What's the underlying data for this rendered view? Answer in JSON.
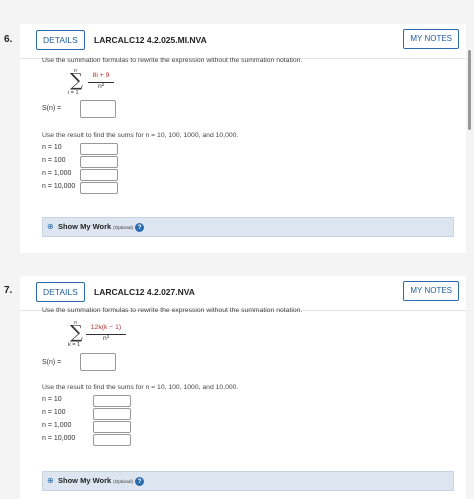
{
  "problems": [
    {
      "number": "6.",
      "details_label": "DETAILS",
      "code": "LARCALC12 4.2.025.MI.NVA",
      "notes_label": "MY NOTES",
      "instruction": "Use the summation formulas to rewrite the expression without the summation notation.",
      "sum_upper": "n",
      "sum_lower": "i = 1",
      "frac_num": "8i + 9",
      "frac_den": "n²",
      "sn_label": "S(n) =",
      "result_instruction": "Use the result to find the sums for n = 10, 100, 1000, and 10,000.",
      "rows": [
        "n =    10",
        "n =   100",
        "n = 1,000",
        "n = 10,000"
      ],
      "show_work": "Show My Work",
      "optional": "(Optional)"
    },
    {
      "number": "7.",
      "details_label": "DETAILS",
      "code": "LARCALC12 4.2.027.NVA",
      "notes_label": "MY NOTES",
      "instruction": "Use the summation formulas to rewrite the expression without the summation notation.",
      "sum_upper": "n",
      "sum_lower": "k = 1",
      "frac_num": "12k(k − 1)",
      "frac_den": "n³",
      "sn_label": "S(n) =",
      "result_instruction": "Use the result to find the sums for n = 10, 100, 1000, and 10,000.",
      "rows": [
        "n = 10",
        "n = 100",
        "n = 1,000",
        "n = 10,000"
      ],
      "show_work": "Show My Work",
      "optional": "(Optional)"
    }
  ],
  "colors": {
    "accent": "#2b6cb0",
    "highlight": "#b03030",
    "show_work_bg": "#dde6f0"
  }
}
